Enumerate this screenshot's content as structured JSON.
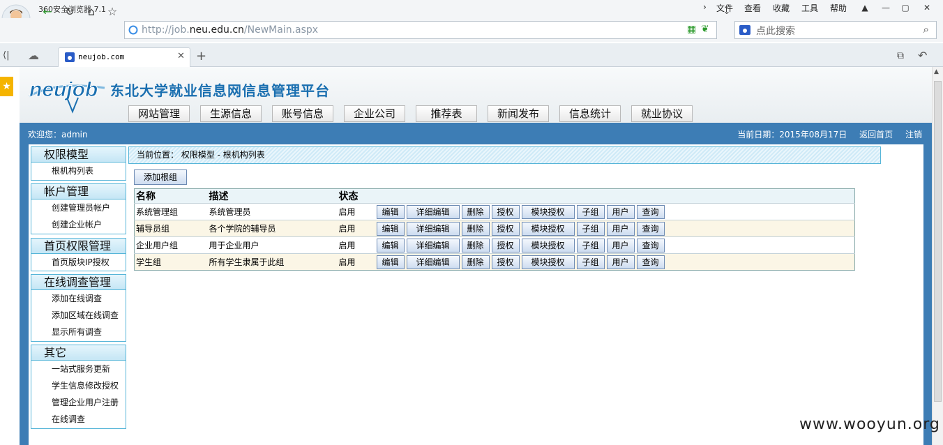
{
  "browser": {
    "app_name": "360安全浏览器 7.1",
    "menu": [
      "文件",
      "查看",
      "收藏",
      "工具",
      "帮助"
    ],
    "url_host": "http://job.",
    "url_domain": "neu.edu.cn",
    "url_path": "/NewMain.aspx",
    "search_placeholder": "点此搜索",
    "tab_title": "neujob.com"
  },
  "site": {
    "logo_text": "neujob",
    "title": "东北大学就业信息网信息管理平台",
    "top_menu": [
      "网站管理",
      "生源信息",
      "账号信息",
      "企业公司",
      "推荐表",
      "新闻发布",
      "信息统计",
      "就业协议"
    ],
    "welcome": "欢迎您：admin",
    "date": "当前日期：2015年08月17日",
    "home_link": "返回首页",
    "logout_link": "注销"
  },
  "sidebar": [
    {
      "title": "权限模型",
      "items": [
        "根机构列表"
      ]
    },
    {
      "title": "帐户管理",
      "items": [
        "创建管理员帐户",
        "创建企业帐户"
      ]
    },
    {
      "title": "首页权限管理",
      "items": [
        "首页版块IP授权"
      ]
    },
    {
      "title": "在线调查管理",
      "items": [
        "添加在线调查",
        "添加区域在线调查",
        "显示所有调查"
      ]
    },
    {
      "title": "其它",
      "items": [
        "一站式服务更新",
        "学生信息修改授权",
        "管理企业用户注册",
        "在线调查"
      ]
    }
  ],
  "breadcrumb": "当前位置： 权限模型 -  根机构列表",
  "add_root_label": "添加根组",
  "table": {
    "headers": [
      "名称",
      "描述",
      "状态"
    ],
    "actions": [
      "编辑",
      "详细编辑",
      "删除",
      "授权",
      "模块授权",
      "子组",
      "用户",
      "查询"
    ],
    "rows": [
      {
        "name": "系统管理组",
        "desc": "系统管理员",
        "status": "启用"
      },
      {
        "name": "辅导员组",
        "desc": "各个学院的辅导员",
        "status": "启用"
      },
      {
        "name": "企业用户组",
        "desc": "用于企业用户",
        "status": "启用"
      },
      {
        "name": "学生组",
        "desc": "所有学生隶属于此组",
        "status": "启用"
      }
    ]
  },
  "watermark": "www.wooyun.org"
}
